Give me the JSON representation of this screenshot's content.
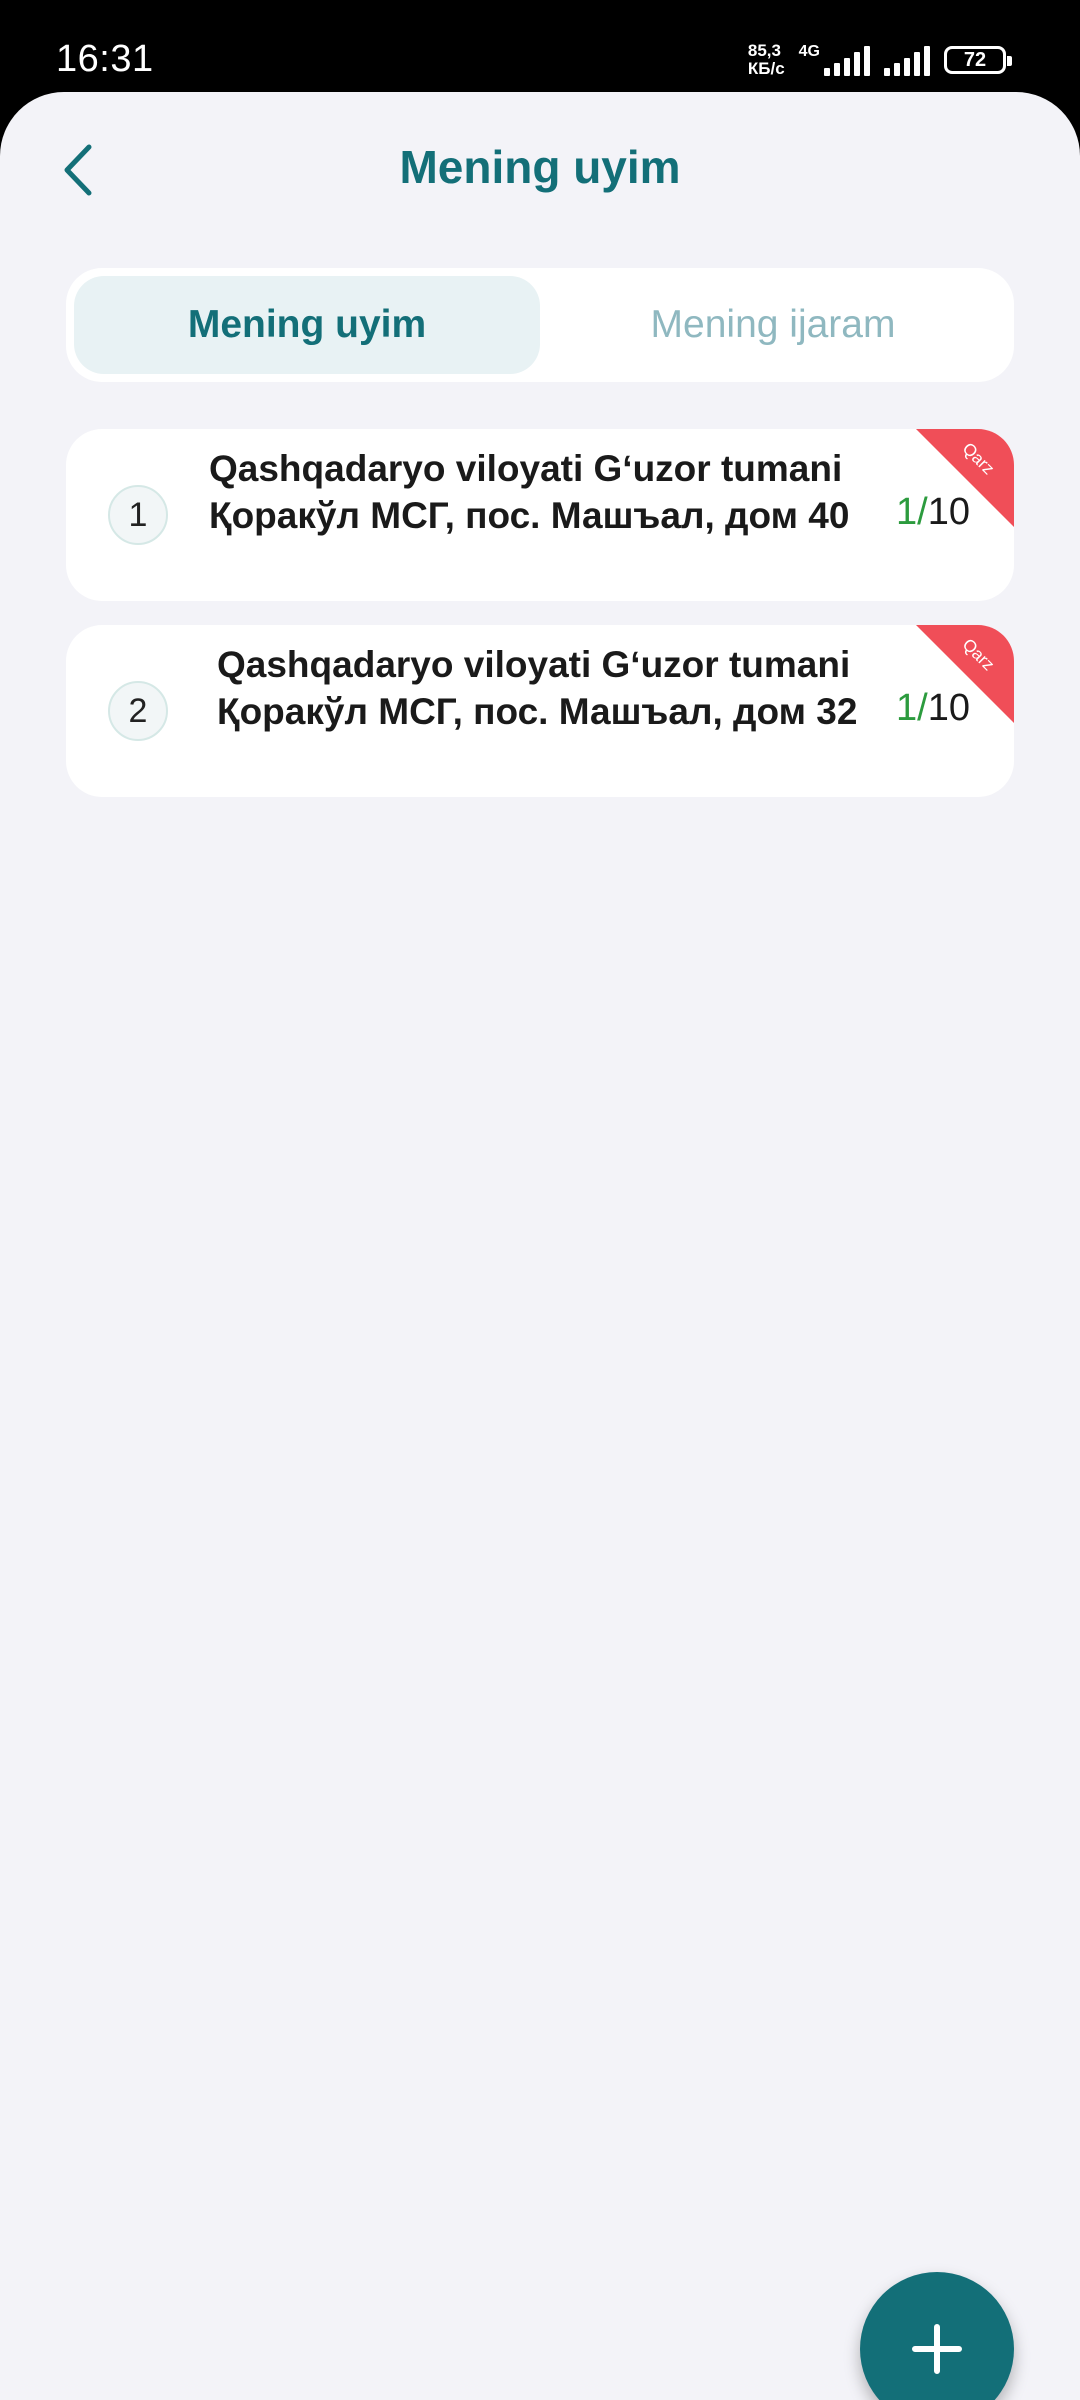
{
  "status_bar": {
    "time": "16:31",
    "net_speed_value": "85,3",
    "net_speed_unit": "КБ/с",
    "network_type": "4G",
    "battery_level": "72"
  },
  "header": {
    "title": "Mening uyim",
    "back_icon": "chevron-left-icon"
  },
  "tabs": [
    {
      "label": "Mening uyim",
      "active": true
    },
    {
      "label": "Mening ijaram",
      "active": false
    }
  ],
  "properties": [
    {
      "number": "1",
      "address": "Qashqadaryo viloyati G‘uzor tumani Қоракўл МСГ, пос. Машъал, дом 40",
      "count_done": "1",
      "count_separator": "/",
      "count_total": "10",
      "badge": "Qarz"
    },
    {
      "number": "2",
      "address": "Qashqadaryo viloyati G‘uzor tumani Қоракўл МСГ, пос. Машъал, дом 32",
      "count_done": "1",
      "count_separator": "/",
      "count_total": "10",
      "badge": "Qarz"
    }
  ],
  "fab": {
    "icon": "plus-icon"
  },
  "colors": {
    "primary": "#136f78",
    "background": "#f3f3f8",
    "badge_debt": "#f04e58",
    "count_done": "#2c9b3e",
    "tab_inactive_text": "#8fb8c0"
  }
}
